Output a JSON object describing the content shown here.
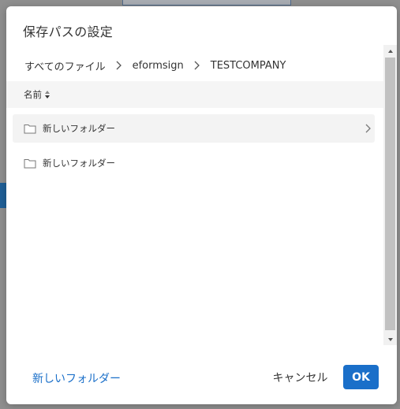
{
  "dialog": {
    "title": "保存パスの設定"
  },
  "breadcrumb": {
    "items": [
      "すべてのファイル",
      "eformsign",
      "TESTCOMPANY"
    ]
  },
  "list": {
    "header_name": "名前",
    "rows": [
      {
        "label": "新しいフォルダー",
        "selected": true,
        "icon": "folder-icon"
      },
      {
        "label": "新しいフォルダー",
        "selected": false,
        "icon": "folder-icon"
      }
    ]
  },
  "footer": {
    "new_folder_label": "新しいフォルダー",
    "cancel_label": "キャンセル",
    "ok_label": "OK"
  },
  "colors": {
    "accent": "#1a6fc9",
    "overlay": "#8f8f8f",
    "selected_row": "#f3f3f3",
    "header_bg": "#f5f5f5"
  }
}
